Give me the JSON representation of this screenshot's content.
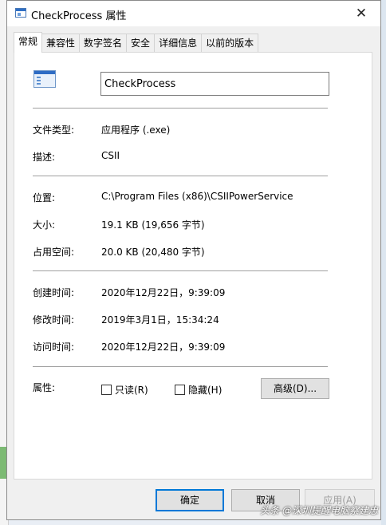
{
  "window": {
    "title": "CheckProcess 属性",
    "close_glyph": "✕"
  },
  "tabs": [
    {
      "label": "常规"
    },
    {
      "label": "兼容性"
    },
    {
      "label": "数字签名"
    },
    {
      "label": "安全"
    },
    {
      "label": "详细信息"
    },
    {
      "label": "以前的版本"
    }
  ],
  "general": {
    "file_name": "CheckProcess",
    "fields": {
      "file_type": {
        "label": "文件类型:",
        "value": "应用程序 (.exe)"
      },
      "description": {
        "label": "描述:",
        "value": "CSII"
      },
      "location": {
        "label": "位置:",
        "value": "C:\\Program Files (x86)\\CSIIPowerService"
      },
      "size": {
        "label": "大小:",
        "value": "19.1 KB (19,656 字节)"
      },
      "size_on_disk": {
        "label": "占用空间:",
        "value": "20.0 KB (20,480 字节)"
      },
      "created": {
        "label": "创建时间:",
        "value": "2020年12月22日，9:39:09"
      },
      "modified": {
        "label": "修改时间:",
        "value": "2019年3月1日，15:34:24"
      },
      "accessed": {
        "label": "访问时间:",
        "value": "2020年12月22日，9:39:09"
      }
    },
    "attributes": {
      "label": "属性:",
      "readonly": "只读(R)",
      "hidden": "隐藏(H)",
      "advanced_button": "高级(D)..."
    }
  },
  "buttons": {
    "ok": "确定",
    "cancel": "取消",
    "apply": "应用(A)"
  },
  "watermark": "头条 @深圳提醒电脑察建忠",
  "colors": {
    "accent": "#0078d7"
  }
}
